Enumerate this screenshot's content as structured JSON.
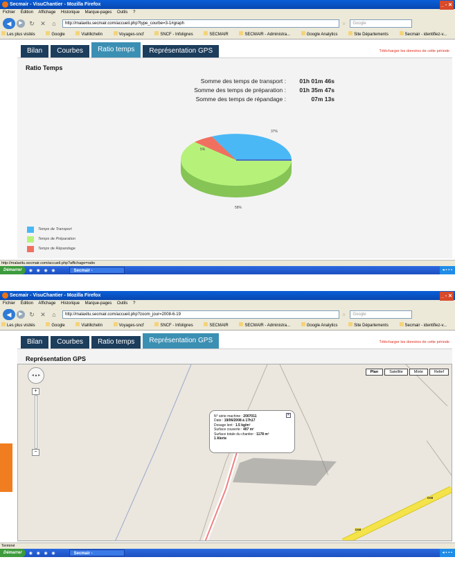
{
  "window_title": "Secmair - VisuChantier - Mozilla Firefox",
  "menu": [
    "Fichier",
    "Édition",
    "Affichage",
    "Historique",
    "Marque-pages",
    "Outils",
    "?"
  ],
  "search_placeholder": "Google",
  "bookmarks": [
    "Les plus visités",
    "Google",
    "ViaMichelin",
    "Voyages-sncf",
    "SNCF - Infolignes",
    "SECMAIR",
    "SECMAIR - Administra...",
    "Google Analytics",
    "Site Départements",
    "Secmair - identifiez-v..."
  ],
  "tabs": [
    "Bilan",
    "Courbes",
    "Ratio temps",
    "Représentation GPS"
  ],
  "download_link": "Télécharger les données de cette période",
  "taskbar": {
    "start": "Démarrer",
    "task": "Secmair - VisuChantie..."
  },
  "colors": {
    "transport": "#4ab8f5",
    "preparation": "#b6f27a",
    "repandage": "#f07060",
    "tab_active": "#3b8fb3",
    "tab": "#1c3d5c"
  },
  "shot1": {
    "url": "http://malaxitu.secmair.com/accueil.php?type_courbe=3-1#graph",
    "panel_title": "Ratio Temps",
    "sums": [
      {
        "label": "Somme des temps de transport :",
        "value": "01h 01m 46s"
      },
      {
        "label": "Somme des temps de préparation :",
        "value": "01h 35m 47s"
      },
      {
        "label": "Somme des temps de répandage :",
        "value": "07m 13s"
      }
    ],
    "pie_labels": {
      "transport": "37%",
      "preparation": "58%",
      "repandage": "5%"
    },
    "legend": [
      "Temps de Transport",
      "Temps de Préparation",
      "Temps de Répandage"
    ],
    "status": "http://malaxitu.secmair.com/accueil.php?affichage=ratio"
  },
  "shot2": {
    "url": "http://malaxitu.secmair.com/accueil.php?zoom_jour=2008-6-19",
    "panel_title": "Représentation GPS",
    "map_types": [
      "Plan",
      "Satellite",
      "Mixte",
      "Relief"
    ],
    "info": {
      "serie_label": "N° série machine :",
      "serie": "2007011",
      "date_label": "Date :",
      "date": "19/06/2008 à 17h17",
      "dosage_label": "Dosage lent :",
      "dosage": "1.5 kg/m²",
      "surface_label": "Surface couverte :",
      "surface": "407 m²",
      "total_label": "Surface totale du chantier :",
      "total": "1178 m²",
      "alerte": "1 Alerte"
    },
    "road_labels": [
      "D58",
      "D58"
    ],
    "status": "Terminé"
  }
}
